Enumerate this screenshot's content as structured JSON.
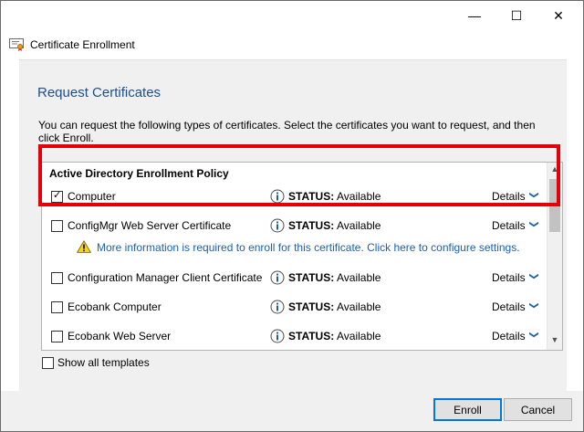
{
  "window": {
    "minimize_glyph": "—",
    "maximize_glyph": "☐",
    "close_glyph": "✕"
  },
  "header": {
    "title": "Certificate Enrollment",
    "icon": "certificate-icon"
  },
  "page": {
    "title": "Request Certificates",
    "description": "You can request the following types of certificates. Select the certificates you want to request, and then click Enroll."
  },
  "policy_group": {
    "label": "Active Directory Enrollment Policy"
  },
  "certificates": [
    {
      "name": "Computer",
      "checked": true,
      "status_label": "STATUS:",
      "status": "Available",
      "details": "Details"
    },
    {
      "name": "ConfigMgr Web Server Certificate",
      "checked": false,
      "status_label": "STATUS:",
      "status": "Available",
      "details": "Details"
    },
    {
      "name": "Configuration Manager Client Certificate",
      "checked": false,
      "status_label": "STATUS:",
      "status": "Available",
      "details": "Details"
    },
    {
      "name": "Ecobank Computer",
      "checked": false,
      "status_label": "STATUS:",
      "status": "Available",
      "details": "Details"
    },
    {
      "name": "Ecobank Web Server",
      "checked": false,
      "status_label": "STATUS:",
      "status": "Available",
      "details": "Details"
    }
  ],
  "warning": {
    "text": "More information is required to enroll for this certificate. Click here to configure settings."
  },
  "show_all": {
    "label": "Show all templates",
    "checked": false
  },
  "buttons": {
    "enroll": "Enroll",
    "cancel": "Cancel"
  },
  "colors": {
    "accent": "#0078d7",
    "title_blue": "#1e4e8c",
    "link_blue": "#1a5fb4",
    "highlight_red": "#e3000b"
  }
}
